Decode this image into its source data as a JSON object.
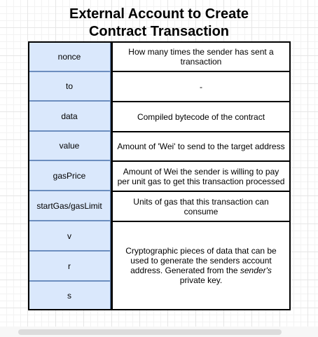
{
  "title": {
    "line1": "External Account to Create",
    "line2": "Contract Transaction"
  },
  "rows": [
    {
      "field": "nonce",
      "description": "How many times the sender has sent a transaction"
    },
    {
      "field": "to",
      "description": "-"
    },
    {
      "field": "data",
      "description": "Compiled bytecode of the contract"
    },
    {
      "field": "value",
      "description": "Amount of 'Wei' to send to the target address"
    },
    {
      "field": "gasPrice",
      "description": "Amount of Wei the sender is willing to pay per unit gas to get this transaction processed"
    },
    {
      "field": "startGas/gasLimit",
      "description": "Units of gas that this transaction can consume"
    },
    {
      "field": "v"
    },
    {
      "field": "r"
    },
    {
      "field": "s"
    }
  ],
  "signature_description": {
    "before": "Cryptographic pieces of data that can be used to generate the senders account address. Generated from the ",
    "emphasis": "sender's",
    "after": " private key."
  },
  "colors": {
    "field_fill": "#dae8fc",
    "field_stroke": "#6c8ebf",
    "border": "#000000"
  }
}
